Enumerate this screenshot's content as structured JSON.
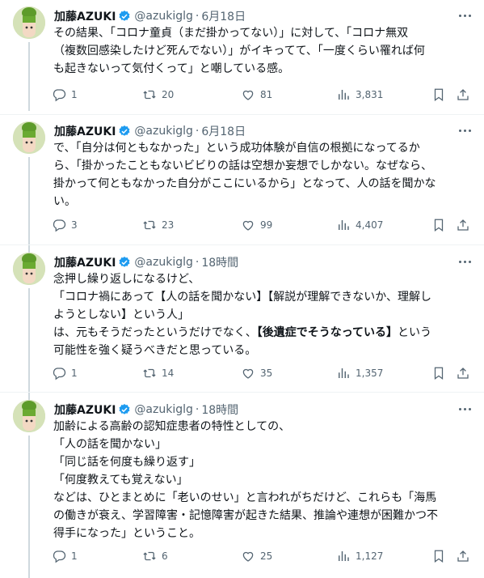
{
  "author": {
    "name": "加藤AZUKI",
    "handle": "@azukiglg"
  },
  "tweets": [
    {
      "time": "6月18日",
      "lines": [
        "その結果、「コロナ童貞（まだ掛かってない）」に対して、「コロナ無双",
        "（複数回感染したけど死んでない）」がイキってて、「一度くらい罹れば何",
        "も起きないって気付くって」と嘲している感。"
      ],
      "replies": "1",
      "retweets": "20",
      "likes": "81",
      "views": "3,831"
    },
    {
      "time": "6月18日",
      "lines": [
        "で、「自分は何ともなかった」という成功体験が自信の根拠になってるか",
        "ら、「掛かったこともないビビりの話は空想か妄想でしかない。なぜなら、",
        "掛かって何ともなかった自分がここにいるから」となって、人の話を聞かな",
        "い。"
      ],
      "replies": "3",
      "retweets": "23",
      "likes": "99",
      "views": "4,407"
    },
    {
      "time": "18時間",
      "lines": [
        "念押し繰り返しになるけど、",
        "「コロナ禍にあって【人の話を聞かない】【解説が理解できないか、理解し",
        "ようとしない】という人」",
        "は、元もそうだったというだけでなく、",
        "という",
        "可能性を強く疑うべきだと思っている。"
      ],
      "bold": "【後遺症でそうなっている】",
      "replies": "1",
      "retweets": "14",
      "likes": "35",
      "views": "1,357"
    },
    {
      "time": "18時間",
      "lines": [
        "加齢による高齢の認知症患者の特性としての、",
        "「人の話を聞かない」",
        "「同じ話を何度も繰り返す」",
        "「何度教えても覚えない」",
        "などは、ひとまとめに「老いのせい」と言われがちだけど、これらも「海馬",
        "の働きが衰え、学習障害・記憶障害が起きた結果、推論や連想が困難かつ不",
        "得手になった」ということ。"
      ],
      "replies": "1",
      "retweets": "6",
      "likes": "25",
      "views": "1,127"
    }
  ]
}
